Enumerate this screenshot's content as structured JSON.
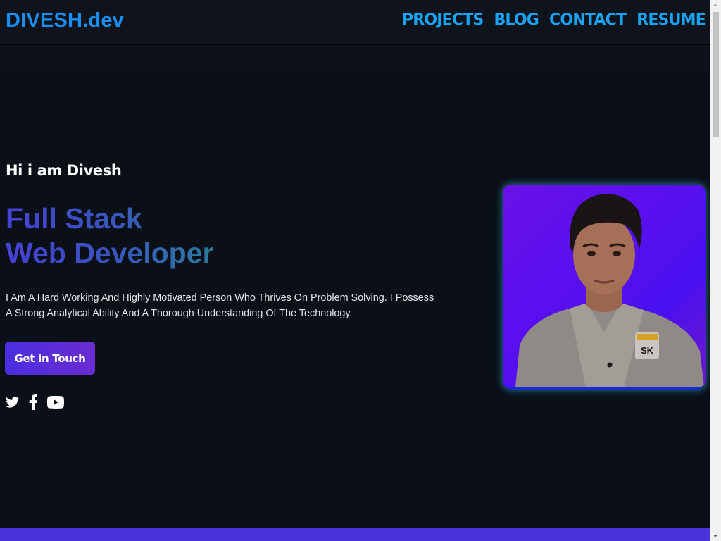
{
  "header": {
    "logo": "DIVESH.dev",
    "nav": [
      "PROJECTS",
      "BLOG",
      "CONTACT",
      "RESUME"
    ]
  },
  "hero": {
    "greeting": "Hi i am Divesh",
    "headline_line1": "Full Stack",
    "headline_line2": "Web Developer",
    "bio": "I Am A Hard Working And Highly Motivated Person Who Thrives On Problem Solving. I Possess A Strong Analytical Ability And A Thorough Understanding Of The Technology.",
    "cta_label": "Get in Touch",
    "social_icons": [
      "twitter-icon",
      "facebook-icon",
      "youtube-icon"
    ]
  },
  "portrait": {
    "badge_text": "SK"
  },
  "colors": {
    "accent": "#1b8ff0",
    "nav": "#17a4f5",
    "background": "#0b0f18",
    "cta_gradient": [
      "#4a2ee0",
      "#6a2ccf"
    ],
    "portrait_bg": "#5a0ff0",
    "footer_band": "#4a32db"
  }
}
